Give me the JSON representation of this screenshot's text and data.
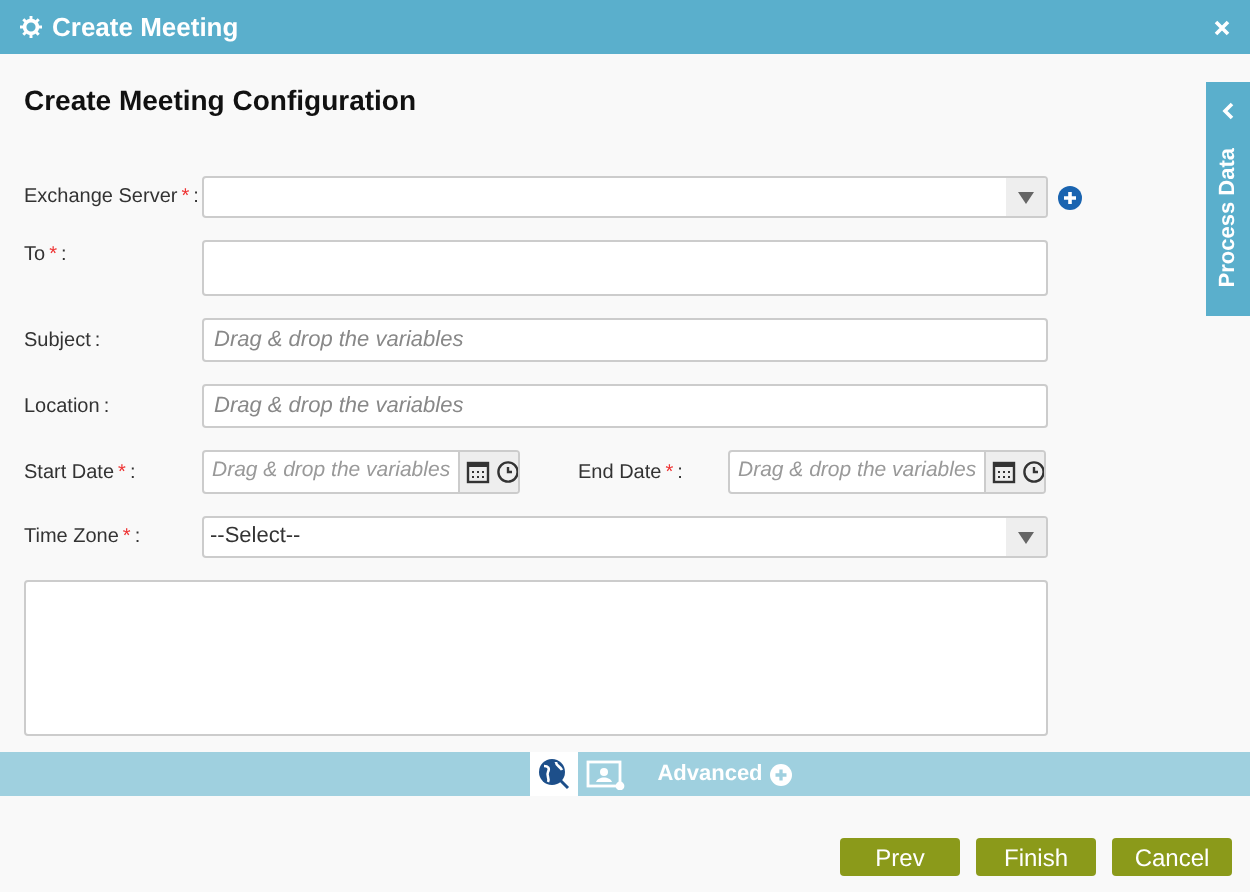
{
  "window": {
    "title": "Create Meeting"
  },
  "heading": "Create Meeting Configuration",
  "side_tab": {
    "label": "Process Data"
  },
  "rows": [
    {
      "kind": "select",
      "label": "Exchange Server",
      "required_mark": "*",
      "colon": ":",
      "add_button": true
    },
    {
      "kind": "textbox",
      "label": "To",
      "required_mark": "*",
      "colon": ":"
    },
    {
      "kind": "text",
      "label": "Subject",
      "colon": ":",
      "placeholder": "Drag & drop the variables"
    },
    {
      "kind": "text",
      "label": "Location",
      "colon": ":",
      "placeholder": "Drag & drop the variables"
    },
    {
      "kind": "dates",
      "fields": [
        {
          "label": "Start Date",
          "required_mark": "*",
          "colon": ":",
          "placeholder": "Drag & drop the variables"
        },
        {
          "label": "End Date",
          "required_mark": "*",
          "colon": ":",
          "placeholder": "Drag & drop the variables"
        }
      ]
    },
    {
      "kind": "select",
      "label": "Time Zone",
      "required_mark": "*",
      "colon": ":",
      "value": "--Select--"
    },
    {
      "kind": "textarea"
    }
  ],
  "tabs": [
    {
      "kind": "globe",
      "selected": true
    },
    {
      "kind": "calendar",
      "selected": false
    },
    {
      "kind": "advanced",
      "label": "Advanced",
      "selected": false
    }
  ],
  "buttons": [
    "Prev",
    "Finish",
    "Cancel"
  ]
}
